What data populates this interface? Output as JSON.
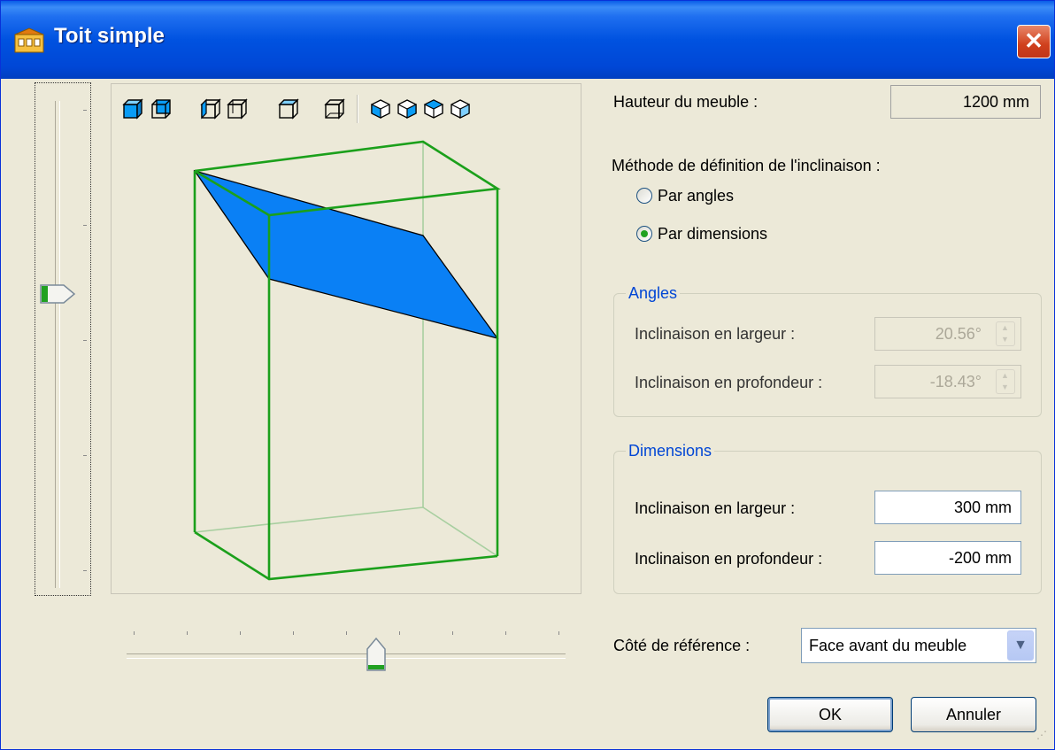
{
  "window": {
    "title": "Toit simple",
    "close_glyph": "✕",
    "icon": "app-icon"
  },
  "hauteur": {
    "label": "Hauteur du meuble :",
    "value": "1200 mm"
  },
  "methode": {
    "label": "Méthode de définition de l'inclinaison :",
    "options": [
      {
        "label": "Par angles",
        "selected": false
      },
      {
        "label": "Par dimensions",
        "selected": true
      }
    ]
  },
  "angles": {
    "title": "Angles",
    "largeur_label": "Inclinaison en largeur :",
    "largeur_value": "20.56°",
    "profondeur_label": "Inclinaison en profondeur :",
    "profondeur_value": "-18.43°",
    "enabled": false
  },
  "dimensions": {
    "title": "Dimensions",
    "largeur_label": "Inclinaison en largeur :",
    "largeur_value": "300 mm",
    "profondeur_label": "Inclinaison en profondeur :",
    "profondeur_value": "-200 mm"
  },
  "reference": {
    "label": "Côté de référence :",
    "value": "Face avant du meuble"
  },
  "buttons": {
    "ok": "OK",
    "cancel": "Annuler"
  },
  "toolbar": {
    "view_buttons": [
      "view-front-icon",
      "view-back-icon",
      "view-left-icon",
      "view-right-icon",
      "view-top-icon",
      "view-bottom-icon"
    ],
    "iso_buttons": [
      "iso-view-1-icon",
      "iso-view-2-icon",
      "iso-view-3-icon",
      "iso-view-4-icon"
    ]
  },
  "sliders": {
    "vertical_level": 0.42,
    "horizontal_level": 0.56
  },
  "colors": {
    "roof_fill": "#0a80f5",
    "box_edge": "#1ba01b",
    "title_bar": "#0052e0"
  }
}
